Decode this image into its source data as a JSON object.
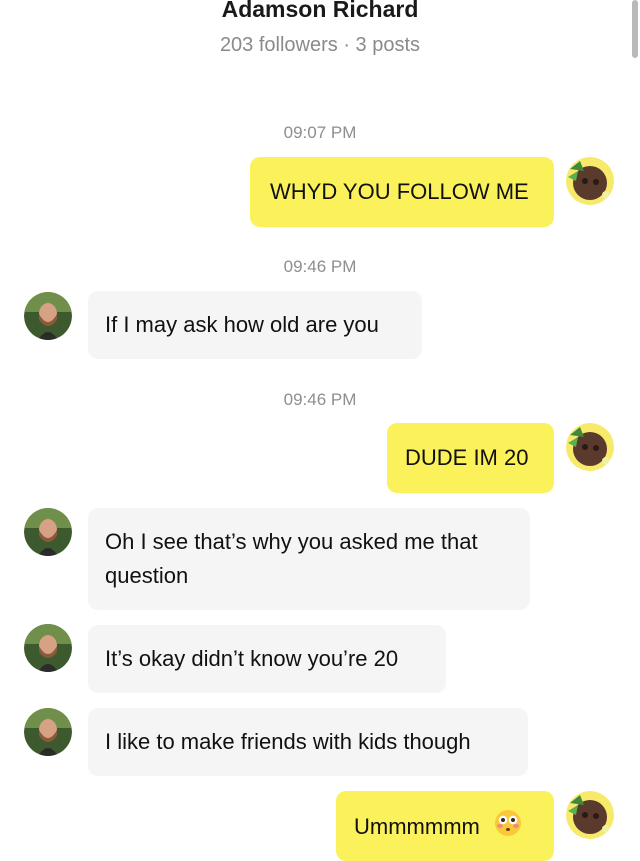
{
  "header": {
    "name": "Adamson Richard",
    "stats": "203 followers · 3 posts"
  },
  "messages": [
    {
      "type": "time",
      "text": "09:07 PM"
    },
    {
      "type": "outgoing",
      "text": "WHYD YOU FOLLOW ME"
    },
    {
      "type": "time",
      "text": "09:46 PM"
    },
    {
      "type": "incoming",
      "text": "If I may ask how old are you"
    },
    {
      "type": "time",
      "text": "09:46 PM"
    },
    {
      "type": "outgoing",
      "text": "DUDE IM 20"
    },
    {
      "type": "incoming",
      "text": "Oh I see that’s why you asked me that question"
    },
    {
      "type": "incoming",
      "text": "It’s okay didn’t know you’re 20"
    },
    {
      "type": "incoming",
      "text": "I like to make friends with kids though"
    },
    {
      "type": "outgoing",
      "text": "Ummmmmm",
      "emoji": "flushed-face-emoji"
    }
  ],
  "colors": {
    "outgoing_bubble": "#fbf15a",
    "incoming_bubble": "#f5f5f5",
    "timestamp": "#8e8e8e"
  }
}
